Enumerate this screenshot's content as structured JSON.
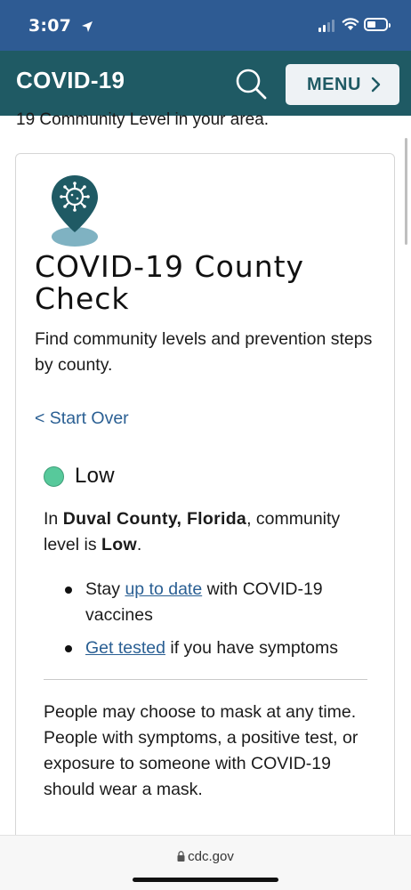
{
  "status_bar": {
    "time": "3:07"
  },
  "header": {
    "title": "COVID-19",
    "menu_label": "MENU",
    "brand_color": "#1f5a64"
  },
  "intro_fragment": "19 Community Level in your area.",
  "card": {
    "icon": "virus-location-pin-icon",
    "title": "COVID-19 County Check",
    "description": "Find community levels and prevention steps by county.",
    "start_over": "< Start Over",
    "level": {
      "label": "Low",
      "color": "#57c99b"
    },
    "county_prefix": "In ",
    "county_name": "Duval County, Florida",
    "county_mid": ", community level is ",
    "county_level": "Low",
    "county_suffix": ".",
    "bullets": [
      {
        "pre": "Stay ",
        "link": "up to date",
        "post": " with COVID-19 vaccines"
      },
      {
        "pre": "",
        "link": "Get tested",
        "post": " if you have symptoms"
      }
    ],
    "mask_guidance": "People may choose to mask at any time. People with symptoms, a positive test, or exposure to someone with COVID-19 should wear a mask."
  },
  "browser": {
    "url": "cdc.gov"
  }
}
